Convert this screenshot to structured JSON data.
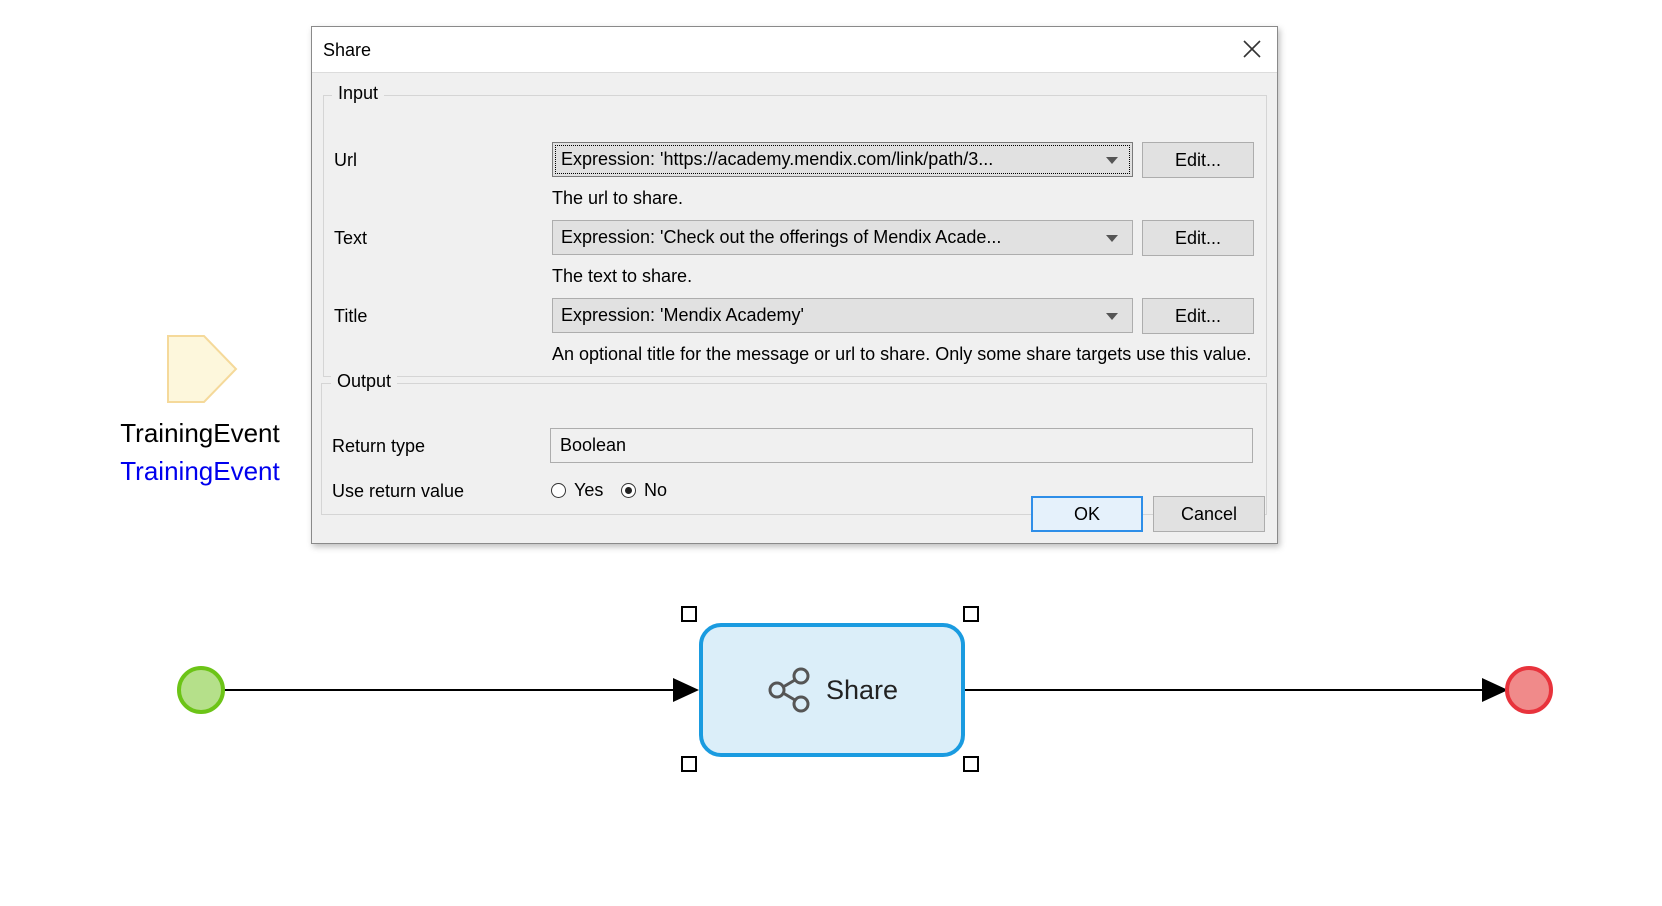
{
  "dialog": {
    "title": "Share",
    "input_group": {
      "legend": "Input",
      "url": {
        "label": "Url",
        "value": "Expression:  'https://academy.mendix.com/link/path/3...",
        "edit_label": "Edit...",
        "help": "The url to share."
      },
      "text": {
        "label": "Text",
        "value": "Expression: 'Check out the offerings of Mendix Acade...",
        "edit_label": "Edit...",
        "help": "The text to share."
      },
      "title": {
        "label": "Title",
        "value": "Expression: 'Mendix Academy'",
        "edit_label": "Edit...",
        "help": "An optional title for the message or url to share. Only some share targets use this value."
      }
    },
    "output_group": {
      "legend": "Output",
      "return_type": {
        "label": "Return type",
        "value": "Boolean"
      },
      "use_return_value": {
        "label": "Use return value",
        "options": [
          {
            "label": "Yes",
            "selected": false
          },
          {
            "label": "No",
            "selected": true
          }
        ]
      }
    },
    "ok_label": "OK",
    "cancel_label": "Cancel"
  },
  "diagram": {
    "parameter": {
      "name": "TrainingEvent",
      "type": "TrainingEvent"
    },
    "activity": {
      "label": "Share",
      "icon": "share-icon"
    }
  },
  "colors": {
    "start_event": "#b5e08a",
    "end_event": "#f08a8a",
    "activity_border": "#1a9be0",
    "activity_fill": "#dbeef9",
    "parameter_fill": "#fdf7dc",
    "parameter_type_text": "#0000ee",
    "default_button_border": "#2e8ee8"
  }
}
